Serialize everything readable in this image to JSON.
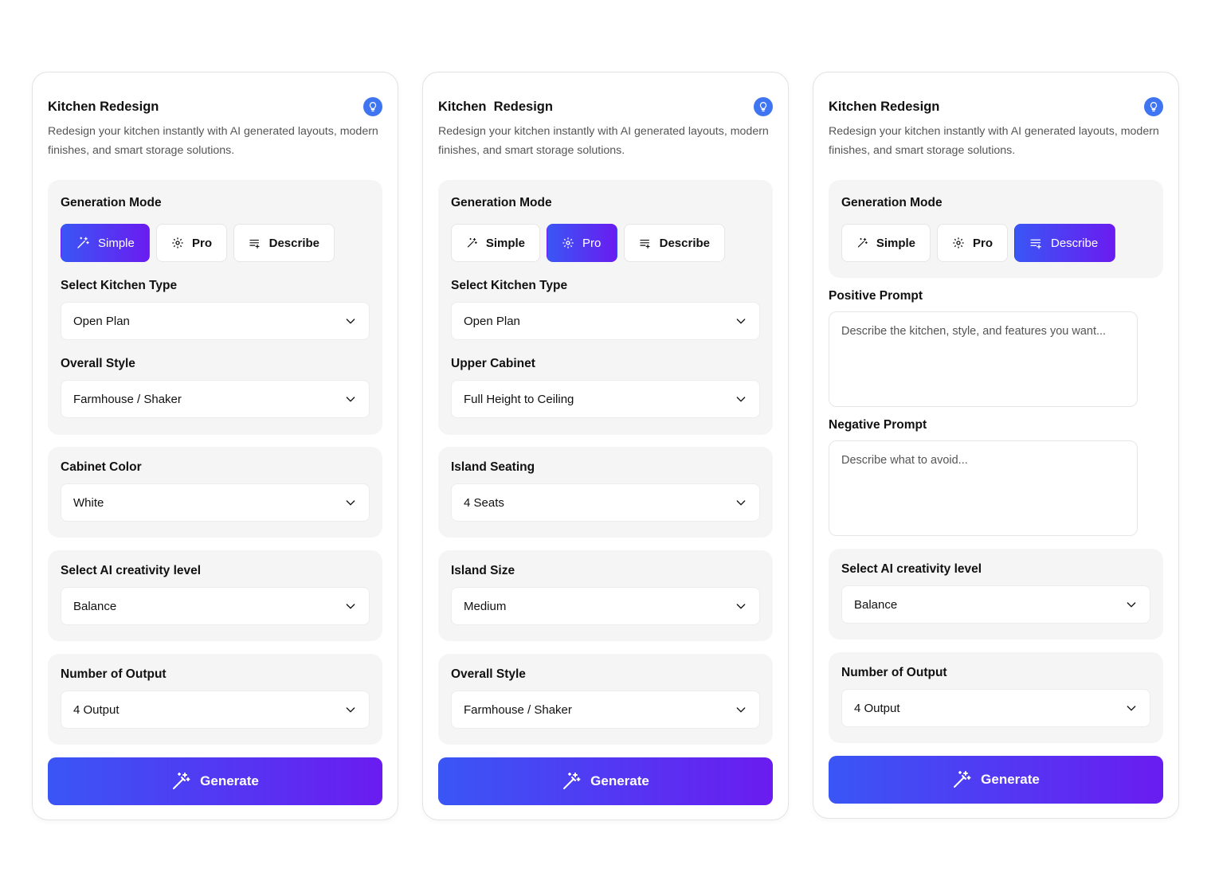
{
  "accent_gradient": [
    "#3a56f5",
    "#6a1cf0"
  ],
  "tip_icon_color": "#3f75f1",
  "cards": [
    {
      "title": "Kitchen Redesign",
      "description": "Redesign your kitchen instantly with AI generated layouts, modern finishes, and smart storage solutions.",
      "tip_icon": "lightbulb-icon",
      "mode_heading": "Generation Mode",
      "modes": [
        {
          "label": "Simple",
          "icon": "magic-wand-icon"
        },
        {
          "label": "Pro",
          "icon": "gear-icon"
        },
        {
          "label": "Describe",
          "icon": "list-plus-icon"
        }
      ],
      "active_mode": "Simple",
      "fields": [
        {
          "label": "Select Kitchen Type",
          "value": "Open Plan"
        },
        {
          "label": "Overall Style",
          "value": "Farmhouse / Shaker"
        },
        {
          "label": "Cabinet Color",
          "value": "White"
        },
        {
          "label": "Select AI creativity level",
          "value": "Balance"
        },
        {
          "label": "Number of Output",
          "value": "4 Output"
        }
      ],
      "generate_label": "Generate"
    },
    {
      "title": "Kitchen  Redesign",
      "description": "Redesign your kitchen instantly with AI generated layouts, modern finishes, and smart storage solutions.",
      "tip_icon": "lightbulb-icon",
      "mode_heading": "Generation Mode",
      "modes": [
        {
          "label": "Simple",
          "icon": "magic-wand-icon"
        },
        {
          "label": "Pro",
          "icon": "gear-icon"
        },
        {
          "label": "Describe",
          "icon": "list-plus-icon"
        }
      ],
      "active_mode": "Pro",
      "fields": [
        {
          "label": "Select Kitchen Type",
          "value": "Open Plan"
        },
        {
          "label": "Upper Cabinet",
          "value": "Full Height to Ceiling"
        },
        {
          "label": "Island Seating",
          "value": "4 Seats"
        },
        {
          "label": "Island Size",
          "value": "Medium"
        },
        {
          "label": "Overall Style",
          "value": "Farmhouse / Shaker"
        }
      ],
      "generate_label": "Generate"
    },
    {
      "title": "Kitchen Redesign",
      "description": "Redesign your kitchen instantly with AI generated layouts, modern finishes, and smart storage solutions.",
      "tip_icon": "lightbulb-icon",
      "mode_heading": "Generation Mode",
      "modes": [
        {
          "label": "Simple",
          "icon": "magic-wand-icon"
        },
        {
          "label": "Pro",
          "icon": "gear-icon"
        },
        {
          "label": "Describe",
          "icon": "list-plus-icon"
        }
      ],
      "active_mode": "Describe",
      "positive_prompt": {
        "label": "Positive Prompt",
        "placeholder": "Describe the kitchen, style, and features you want..."
      },
      "negative_prompt": {
        "label": "Negative Prompt",
        "placeholder": "Describe what to avoid..."
      },
      "fields": [
        {
          "label": "Select AI creativity level",
          "value": "Balance"
        },
        {
          "label": "Number of Output",
          "value": "4 Output"
        }
      ],
      "generate_label": "Generate"
    }
  ]
}
